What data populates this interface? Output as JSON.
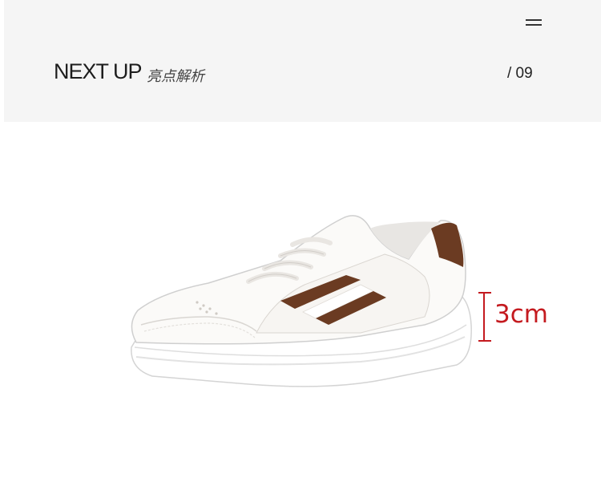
{
  "header": {
    "title": "NEXT UP",
    "subtitle": "亮点解析",
    "page_number": "/ 09",
    "menu_icon": "menu-icon"
  },
  "product": {
    "image": "white-sneaker-brown-stripes",
    "heel_height_label": "3cm"
  },
  "colors": {
    "header_bg": "#f5f5f5",
    "accent_red": "#c41a1f",
    "stripe_brown": "#6b3b22"
  }
}
